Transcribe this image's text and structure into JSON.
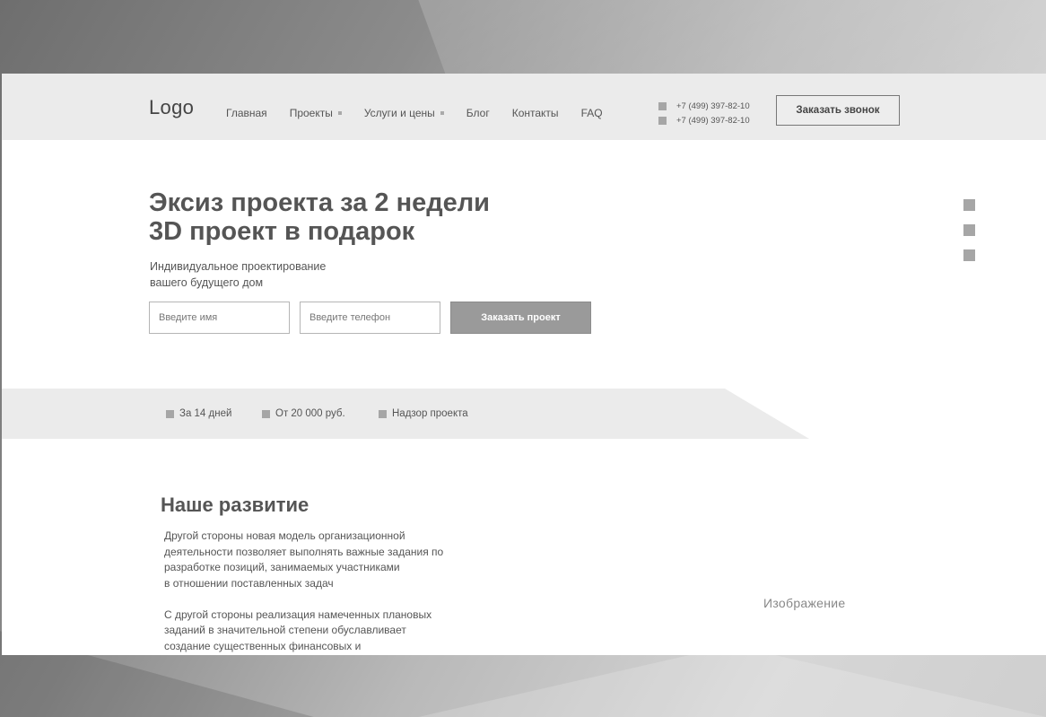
{
  "header": {
    "logo": "Logo",
    "nav": [
      {
        "label": "Главная",
        "dropdown": false
      },
      {
        "label": "Проекты",
        "dropdown": true
      },
      {
        "label": "Услуги и цены",
        "dropdown": true
      },
      {
        "label": "Блог",
        "dropdown": false
      },
      {
        "label": "Контакты",
        "dropdown": false
      },
      {
        "label": "FAQ",
        "dropdown": false
      }
    ],
    "phones": [
      "+7 (499) 397-82-10",
      "+7 (499) 397-82-10"
    ],
    "call_button": "Заказать звонок"
  },
  "hero": {
    "title_line1": "Эксиз проекта за 2 недели",
    "title_line2": "3D проект в подарок",
    "subtitle_line1": "Индивидуальное проектирование",
    "subtitle_line2": "вашего будущего дом",
    "name_placeholder": "Введите имя",
    "phone_placeholder": "Введите телефон",
    "order_button": "Заказать проект",
    "slider_dots": 3
  },
  "features": [
    {
      "label": "За 14 дней"
    },
    {
      "label": "От 20 000 руб."
    },
    {
      "label": "Надзор проекта"
    }
  ],
  "about": {
    "title": "Наше развитие",
    "paragraph1_lines": [
      "Другой стороны новая модель организационной",
      "деятельности позволяет выполнять важные задания по",
      "разработке позиций, занимаемых участниками",
      "в отношении поставленных задач"
    ],
    "paragraph2_lines": [
      "С другой стороны реализация намеченных плановых",
      "заданий в значительной степени обуславливает",
      "создание существенных финансовых и"
    ],
    "image_placeholder": "Изображение"
  },
  "colors": {
    "header_bg": "#ebebeb",
    "accent_button": "#9a9a9a",
    "text": "#555555",
    "bullet": "#a6a6a6"
  }
}
